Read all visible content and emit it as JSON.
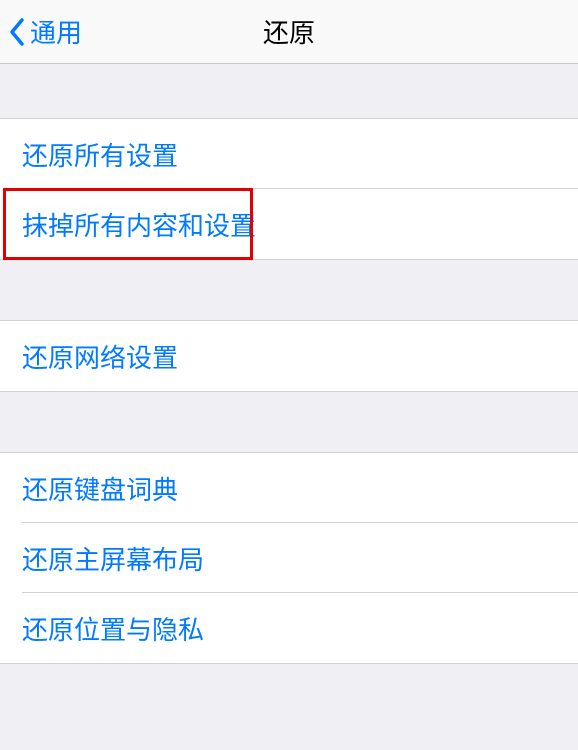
{
  "nav": {
    "back_label": "通用",
    "title": "还原"
  },
  "group1": {
    "item0": "还原所有设置",
    "item1": "抹掉所有内容和设置"
  },
  "group2": {
    "item0": "还原网络设置"
  },
  "group3": {
    "item0": "还原键盘词典",
    "item1": "还原主屏幕布局",
    "item2": "还原位置与隐私"
  }
}
